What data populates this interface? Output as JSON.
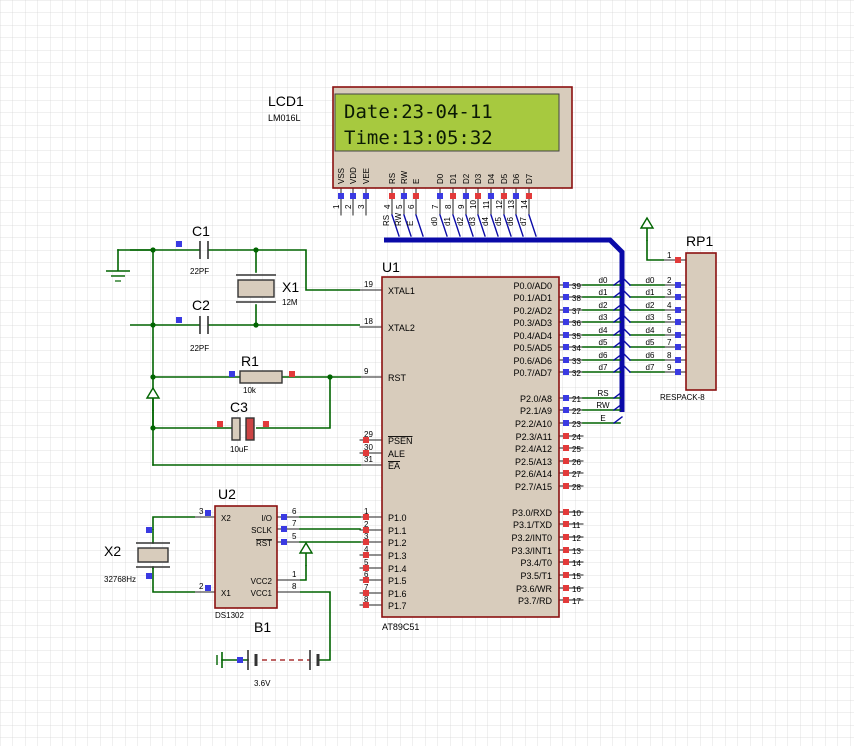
{
  "lcd": {
    "ref": "LCD1",
    "model": "LM016L",
    "line1": "Date:23-04-11",
    "line2": "Time:13:05:32",
    "pin_labels": [
      "VSS",
      "VDD",
      "VEE",
      "RS",
      "RW",
      "E",
      "D0",
      "D1",
      "D2",
      "D3",
      "D4",
      "D5",
      "D6",
      "D7"
    ],
    "pin_numbers": [
      "1",
      "2",
      "3",
      "4",
      "5",
      "6",
      "7",
      "8",
      "9",
      "10",
      "11",
      "12",
      "13",
      "14"
    ],
    "net_labels": [
      "RS",
      "RW",
      "E",
      "d0",
      "d1",
      "d2",
      "d3",
      "d4",
      "d5",
      "d6",
      "d7"
    ]
  },
  "mcu": {
    "ref": "U1",
    "model": "AT89C51",
    "left_pins": [
      {
        "num": "19",
        "name": "XTAL1"
      },
      {
        "num": "18",
        "name": "XTAL2"
      },
      {
        "num": "9",
        "name": "RST"
      },
      {
        "num": "29",
        "name": "PSEN"
      },
      {
        "num": "30",
        "name": "ALE"
      },
      {
        "num": "31",
        "name": "EA"
      },
      {
        "num": "1",
        "name": "P1.0"
      },
      {
        "num": "2",
        "name": "P1.1"
      },
      {
        "num": "3",
        "name": "P1.2"
      },
      {
        "num": "4",
        "name": "P1.3"
      },
      {
        "num": "5",
        "name": "P1.4"
      },
      {
        "num": "6",
        "name": "P1.5"
      },
      {
        "num": "7",
        "name": "P1.6"
      },
      {
        "num": "8",
        "name": "P1.7"
      }
    ],
    "right_pins": [
      {
        "num": "39",
        "name": "P0.0/AD0",
        "net": "d0"
      },
      {
        "num": "38",
        "name": "P0.1/AD1",
        "net": "d1"
      },
      {
        "num": "37",
        "name": "P0.2/AD2",
        "net": "d2"
      },
      {
        "num": "36",
        "name": "P0.3/AD3",
        "net": "d3"
      },
      {
        "num": "35",
        "name": "P0.4/AD4",
        "net": "d4"
      },
      {
        "num": "34",
        "name": "P0.5/AD5",
        "net": "d5"
      },
      {
        "num": "33",
        "name": "P0.6/AD6",
        "net": "d6"
      },
      {
        "num": "32",
        "name": "P0.7/AD7",
        "net": "d7"
      },
      {
        "num": "21",
        "name": "P2.0/A8",
        "net": "RS"
      },
      {
        "num": "22",
        "name": "P2.1/A9",
        "net": "RW"
      },
      {
        "num": "23",
        "name": "P2.2/A10",
        "net": "E"
      },
      {
        "num": "24",
        "name": "P2.3/A11",
        "net": ""
      },
      {
        "num": "25",
        "name": "P2.4/A12",
        "net": ""
      },
      {
        "num": "26",
        "name": "P2.5/A13",
        "net": ""
      },
      {
        "num": "27",
        "name": "P2.6/A14",
        "net": ""
      },
      {
        "num": "28",
        "name": "P2.7/A15",
        "net": ""
      },
      {
        "num": "10",
        "name": "P3.0/RXD",
        "net": ""
      },
      {
        "num": "11",
        "name": "P3.1/TXD",
        "net": ""
      },
      {
        "num": "12",
        "name": "P3.2/INT0",
        "net": ""
      },
      {
        "num": "13",
        "name": "P3.3/INT1",
        "net": ""
      },
      {
        "num": "14",
        "name": "P3.4/T0",
        "net": ""
      },
      {
        "num": "15",
        "name": "P3.5/T1",
        "net": ""
      },
      {
        "num": "16",
        "name": "P3.6/WR",
        "net": ""
      },
      {
        "num": "17",
        "name": "P3.7/RD",
        "net": ""
      }
    ]
  },
  "rp1": {
    "ref": "RP1",
    "model": "RESPACK-8",
    "pins": [
      "1",
      "2",
      "3",
      "4",
      "5",
      "6",
      "7",
      "8",
      "9"
    ],
    "nets": [
      "d0",
      "d1",
      "d2",
      "d3",
      "d4",
      "d5",
      "d6",
      "d7"
    ]
  },
  "c1": {
    "ref": "C1",
    "value": "22PF"
  },
  "c2": {
    "ref": "C2",
    "value": "22PF"
  },
  "x1": {
    "ref": "X1",
    "value": "12M"
  },
  "r1": {
    "ref": "R1",
    "value": "10k"
  },
  "c3": {
    "ref": "C3",
    "value": "10uF"
  },
  "u2": {
    "ref": "U2",
    "model": "DS1302",
    "pins": [
      {
        "num": "3",
        "name": "X2"
      },
      {
        "num": "2",
        "name": "X1"
      },
      {
        "num": "6",
        "name": "I/O"
      },
      {
        "num": "7",
        "name": "SCLK"
      },
      {
        "num": "5",
        "name": "RST"
      },
      {
        "num": "1",
        "name": "VCC2"
      },
      {
        "num": "8",
        "name": "VCC1"
      }
    ]
  },
  "x2": {
    "ref": "X2",
    "value": "32768Hz"
  },
  "b1": {
    "ref": "B1",
    "value": "3.6V"
  },
  "colors": {
    "wire": "#006400",
    "bus": "#0a0aa8",
    "body": "#d8ccbc",
    "body_border": "#8b1010",
    "lcd_screen": "#a7c93f",
    "lcd_text": "#0b1a05",
    "pin_red": "#e23a3a",
    "pin_blue": "#3a3ae2",
    "grid": "#d6d6d6"
  }
}
